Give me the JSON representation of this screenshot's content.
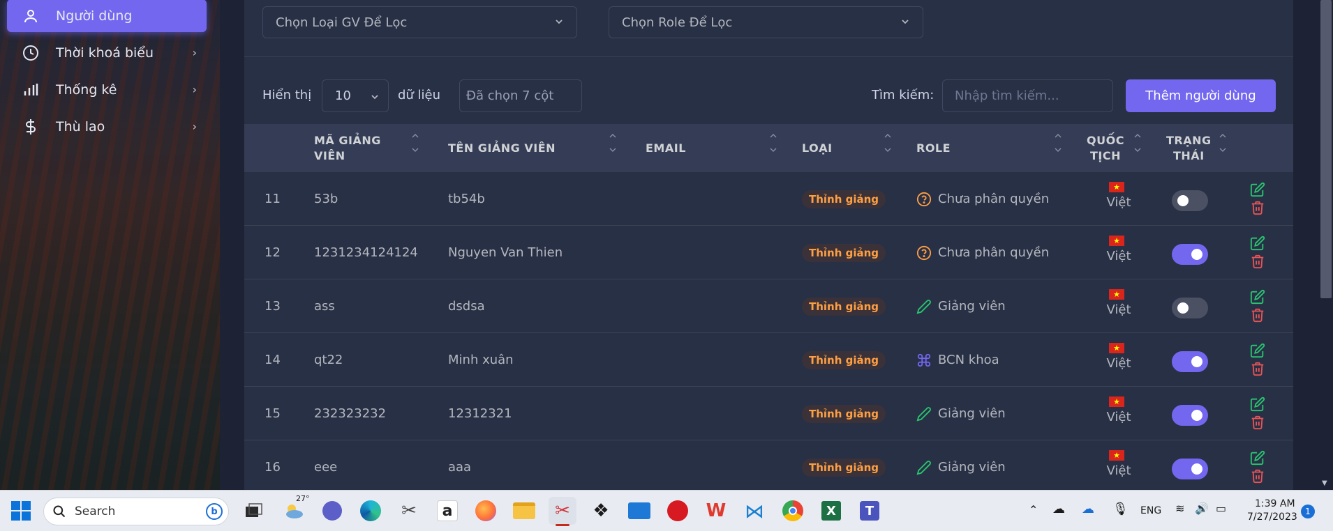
{
  "sidebar": {
    "items": [
      {
        "label": "Người dùng",
        "icon": "user-icon",
        "active": true
      },
      {
        "label": "Thời khoá biểu",
        "icon": "clock-icon",
        "active": false
      },
      {
        "label": "Thống kê",
        "icon": "bar-chart-icon",
        "active": false
      },
      {
        "label": "Thù lao",
        "icon": "dollar-icon",
        "active": false
      }
    ]
  },
  "filters": {
    "type_placeholder": "Chọn Loại GV Để Lọc",
    "role_placeholder": "Chọn Role Để Lọc"
  },
  "controls": {
    "show_label": "Hiển thị",
    "page_size": "10",
    "data_label": "dữ liệu",
    "columns_selected": "Đã chọn 7 cột",
    "search_label": "Tìm kiếm:",
    "search_placeholder": "Nhập tìm kiếm...",
    "add_user_label": "Thêm người dùng"
  },
  "table": {
    "headers": {
      "code": [
        "MÃ GIẢNG",
        "VIÊN"
      ],
      "name": "TÊN GIẢNG VIÊN",
      "email": "EMAIL",
      "type": "LOẠI",
      "role": "ROLE",
      "nationality": [
        "QUỐC",
        "TỊCH"
      ],
      "status": [
        "TRẠNG",
        "THÁI"
      ]
    },
    "rows": [
      {
        "index": "11",
        "code": "53b",
        "name": "tb54b",
        "email": "",
        "type": "Thỉnh giảng",
        "role": "Chưa phân quyền",
        "role_icon": "question-circle-icon",
        "nationality": "Việt",
        "active": false
      },
      {
        "index": "12",
        "code": "1231234124124",
        "name": "Nguyen Van Thien",
        "email": "",
        "type": "Thỉnh giảng",
        "role": "Chưa phân quyền",
        "role_icon": "question-circle-icon",
        "nationality": "Việt",
        "active": true
      },
      {
        "index": "13",
        "code": "ass",
        "name": "dsdsa",
        "email": "",
        "type": "Thỉnh giảng",
        "role": "Giảng viên",
        "role_icon": "pencil-icon",
        "nationality": "Việt",
        "active": false
      },
      {
        "index": "14",
        "code": "qt22",
        "name": "Minh xuân",
        "email": "",
        "type": "Thỉnh giảng",
        "role": "BCN khoa",
        "role_icon": "command-icon",
        "nationality": "Việt",
        "active": true
      },
      {
        "index": "15",
        "code": "232323232",
        "name": "12312321",
        "email": "",
        "type": "Thỉnh giảng",
        "role": "Giảng viên",
        "role_icon": "pencil-icon",
        "nationality": "Việt",
        "active": true
      },
      {
        "index": "16",
        "code": "eee",
        "name": "aaa",
        "email": "",
        "type": "Thỉnh giảng",
        "role": "Giảng viên",
        "role_icon": "pencil-icon",
        "nationality": "Việt",
        "active": true
      }
    ]
  },
  "taskbar": {
    "search_label": "Search",
    "weather_temp": "27°",
    "language": "ENG",
    "time": "1:39 AM",
    "date": "7/27/2023",
    "notification_count": "1"
  },
  "colors": {
    "accent": "#7367f0",
    "warning": "#ff9f43",
    "success": "#28c76f",
    "danger": "#ea5455",
    "card_bg": "#283046",
    "table_head_bg": "#343d55"
  }
}
